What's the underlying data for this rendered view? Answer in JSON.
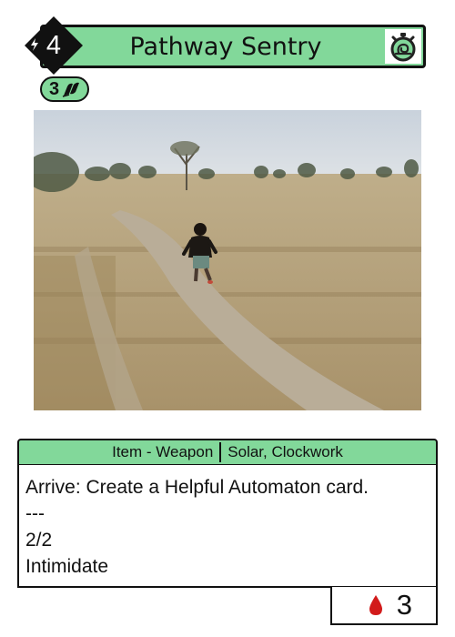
{
  "card": {
    "cost": "4",
    "name": "Pathway Sentry",
    "stat": "3",
    "type_left": "Item - Weapon",
    "type_right": "Solar, Clockwork",
    "text_lines": [
      "Arrive: Create a Helpful Automaton card.",
      "---",
      "2/2",
      "Intimidate"
    ],
    "bottom_value": "3"
  },
  "icons": {
    "cost_icon": "lightning-bolt-icon",
    "title_icon": "stopwatch-snail-icon",
    "stat_icon": "scroll-quill-icon",
    "bottom_icon": "blood-drop-icon"
  },
  "colors": {
    "accent_green": "#82d89a",
    "drop_red": "#d21b1b"
  }
}
